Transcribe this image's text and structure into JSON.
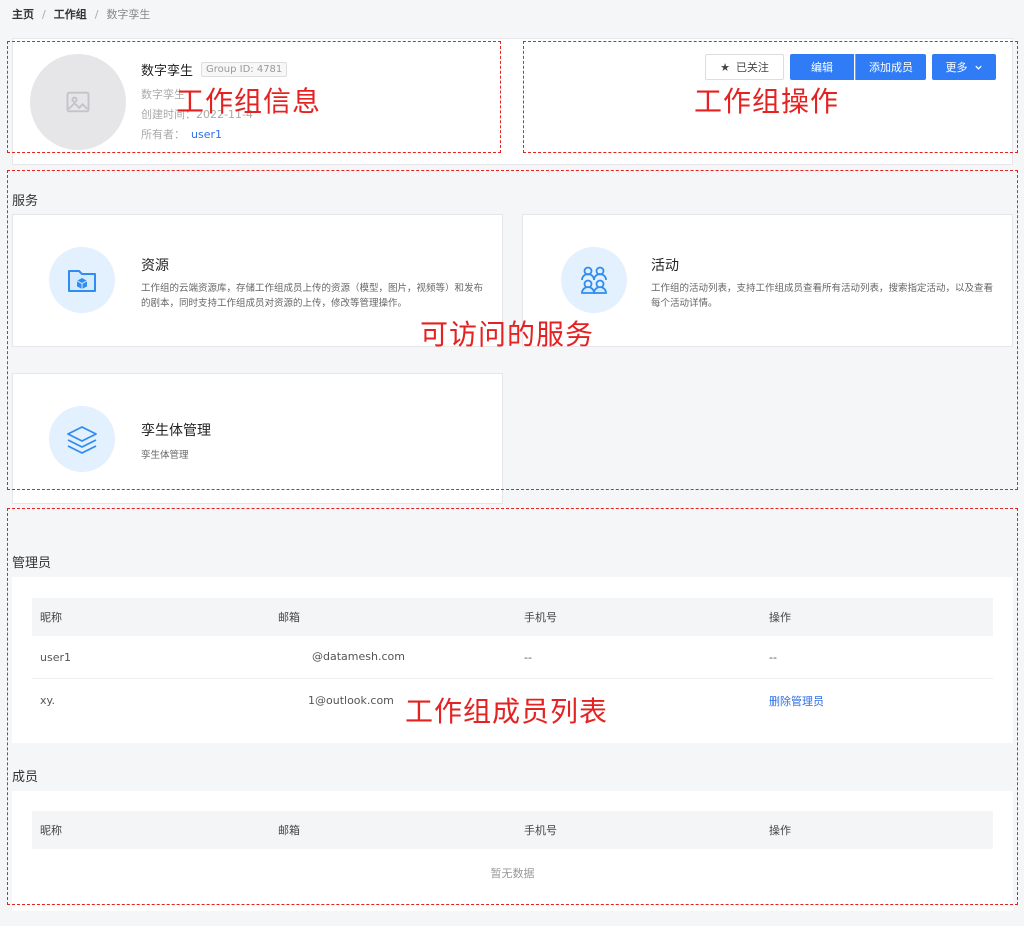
{
  "breadcrumb": {
    "home": "主页",
    "group": "工作组",
    "current": "数字孪生"
  },
  "group": {
    "name": "数字孪生",
    "id_label": "Group ID: 4781",
    "description": "数字孪生",
    "created": "创建时间：2022-11-4",
    "owner_label": "所有者：",
    "owner": "user1"
  },
  "actions": {
    "follow": "已关注",
    "edit": "编辑",
    "add_member": "添加成员",
    "more": "更多"
  },
  "services": {
    "title": "服务",
    "items": [
      {
        "title": "资源",
        "desc": "工作组的云端资源库，存储工作组成员上传的资源（模型，图片，视频等）和发布的剧本，同时支持工作组成员对资源的上传，修改等管理操作。",
        "icon": "folder-icon"
      },
      {
        "title": "活动",
        "desc": "工作组的活动列表，支持工作组成员查看所有活动列表，搜索指定活动，以及查看每个活动详情。",
        "icon": "people-icon"
      },
      {
        "title": "孪生体管理",
        "desc": "孪生体管理",
        "icon": "layers-icon"
      }
    ]
  },
  "admins": {
    "title": "管理员",
    "columns": [
      "昵称",
      "邮箱",
      "手机号",
      "操作"
    ],
    "rows": [
      {
        "nick": "user1",
        "email": "@datamesh.com",
        "phone": "--",
        "action": "--"
      },
      {
        "nick": "xy.",
        "email": "1@outlook.com",
        "phone": "",
        "action": "删除管理员"
      }
    ]
  },
  "members": {
    "title": "成员",
    "columns": [
      "昵称",
      "邮箱",
      "手机号",
      "操作"
    ],
    "empty": "暂无数据"
  },
  "annotations": {
    "info": "工作组信息",
    "ops": "工作组操作",
    "services": "可访问的服务",
    "members": "工作组成员列表"
  },
  "colors": {
    "accent": "#2f7cf6",
    "annotation": "#e52222"
  }
}
